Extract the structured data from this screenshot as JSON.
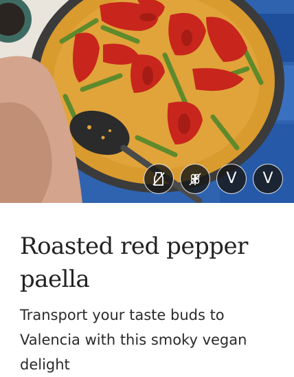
{
  "recipe": {
    "title": "Roasted red pepper paella",
    "description": "Transport your taste buds to Valencia with this smoky vegan delight"
  },
  "diet_badges": [
    {
      "icon": "dairy-free-icon",
      "label": ""
    },
    {
      "icon": "gluten-free-icon",
      "label": ""
    },
    {
      "icon": "vegetarian-icon",
      "label": "V"
    },
    {
      "icon": "vegan-icon",
      "label": "V"
    }
  ],
  "colors": {
    "pan_rim": "#3a3a3a",
    "rice": "#d99a2e",
    "pepper": "#c8261c",
    "bean": "#5e8a2c",
    "tile_blue": "#2a57a8",
    "napkin": "#d4a48c"
  }
}
